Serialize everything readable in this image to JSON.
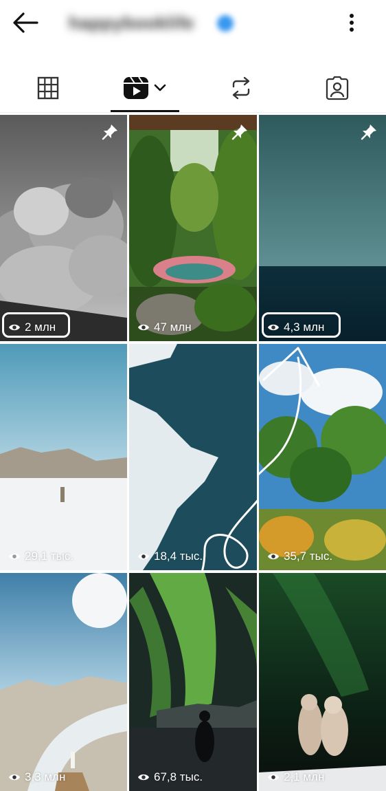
{
  "header": {
    "username": "happybooklife",
    "back_icon": "arrow-left-icon",
    "more_icon": "more-vertical-icon",
    "verified_icon": "verified-badge-icon"
  },
  "tabs": [
    {
      "name": "posts",
      "icon": "grid-icon",
      "active": false
    },
    {
      "name": "reels",
      "icon": "reels-icon",
      "active": true,
      "has_dropdown": true
    },
    {
      "name": "reposts",
      "icon": "repost-icon",
      "active": false
    },
    {
      "name": "tagged",
      "icon": "tagged-icon",
      "active": false
    }
  ],
  "colors": {
    "accent_dark": "#111111",
    "overlay_text": "#ffffff"
  },
  "reels": [
    {
      "views": "2 млн",
      "pinned": true,
      "highlighted": true,
      "scene": "smoke cloud black and white"
    },
    {
      "views": "47 млн",
      "pinned": true,
      "highlighted": false,
      "scene": "tropical pool with palms"
    },
    {
      "views": "4,3 млн",
      "pinned": true,
      "highlighted": true,
      "scene": "ocean horizon"
    },
    {
      "views": "29,1 тыс.",
      "pinned": false,
      "highlighted": false,
      "scene": "person on snowy plain"
    },
    {
      "views": "18,4 тыс.",
      "pinned": false,
      "highlighted": false,
      "scene": "aerial ice coast"
    },
    {
      "views": "35,7 тыс.",
      "pinned": false,
      "highlighted": false,
      "scene": "tropical palm trees"
    },
    {
      "views": "3,3 млн",
      "pinned": false,
      "highlighted": false,
      "scene": "glacier valley with person"
    },
    {
      "views": "67,8 тыс.",
      "pinned": false,
      "highlighted": false,
      "scene": "northern lights with silhouette"
    },
    {
      "views": "2,1 млн",
      "pinned": false,
      "highlighted": false,
      "scene": "aurora with snow sculpture"
    }
  ]
}
